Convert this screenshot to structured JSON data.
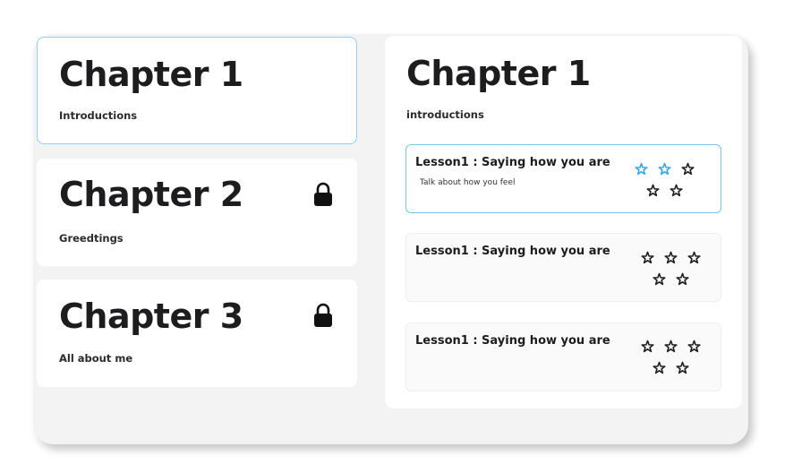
{
  "chapters": [
    {
      "title": "Chapter 1",
      "subtitle": "Introductions",
      "locked": false,
      "selected": true
    },
    {
      "title": "Chapter 2",
      "subtitle": "Greedtings",
      "locked": true,
      "selected": false
    },
    {
      "title": "Chapter 3",
      "subtitle": "All about me",
      "locked": true,
      "selected": false
    }
  ],
  "detail": {
    "title": "Chapter 1",
    "subtitle": "introductions",
    "lessons": [
      {
        "title": "Lesson1 : Saying how you are",
        "description": "Talk about how you feel",
        "stars_earned": 2,
        "stars_total": 5,
        "selected": true
      },
      {
        "title": "Lesson1 : Saying how you are",
        "description": "",
        "stars_earned": 0,
        "stars_total": 5,
        "selected": false
      },
      {
        "title": "Lesson1 : Saying how you are",
        "description": "",
        "stars_earned": 0,
        "stars_total": 5,
        "selected": false
      }
    ]
  },
  "colors": {
    "accent": "#2ea8ee",
    "selected_border": "#8fcff3",
    "text": "#1d1d1f"
  },
  "icons": {
    "lock": "lock-icon",
    "star": "star-icon"
  }
}
